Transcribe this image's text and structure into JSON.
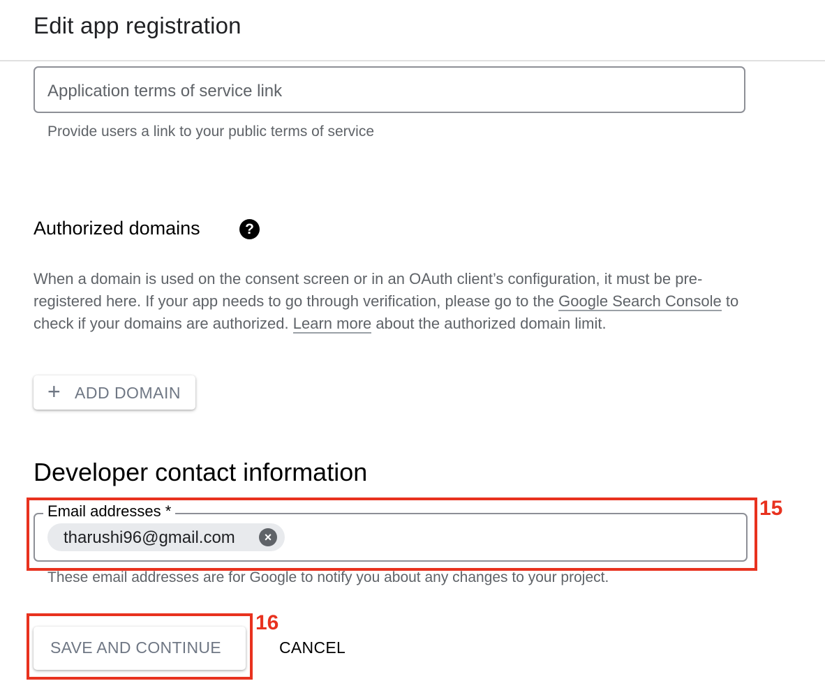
{
  "header": {
    "title": "Edit app registration"
  },
  "tos": {
    "placeholder": "Application terms of service link",
    "hint": "Provide users a link to your public terms of service"
  },
  "authorized_domains": {
    "heading": "Authorized domains",
    "help_icon": "help-circle-icon",
    "text_1": "When a domain is used on the consent screen or in an OAuth client’s configuration, it must be pre-registered here. If your app needs to go through verification, please go to the ",
    "link_1": "Google Search Console",
    "text_2": " to check if your domains are authorized. ",
    "link_2": "Learn more",
    "text_3": " about the authorized domain limit.",
    "add_button_icon": "plus-icon",
    "add_button_label": "ADD DOMAIN"
  },
  "developer_contact": {
    "heading": "Developer contact information",
    "field_label": "Email addresses *",
    "chip_value": "tharushi96@gmail.com",
    "chip_remove_icon": "close-circle-icon",
    "hint": "These email addresses are for Google to notify you about any changes to your project."
  },
  "actions": {
    "save_label": "SAVE AND CONTINUE",
    "cancel_label": "CANCEL"
  },
  "annotations": {
    "step_15": "15",
    "step_16": "16"
  },
  "colors": {
    "annotation_red": "#e8321f",
    "field_border": "#8d8f96",
    "muted_text": "#5f6368",
    "button_text": "#6f7784"
  }
}
